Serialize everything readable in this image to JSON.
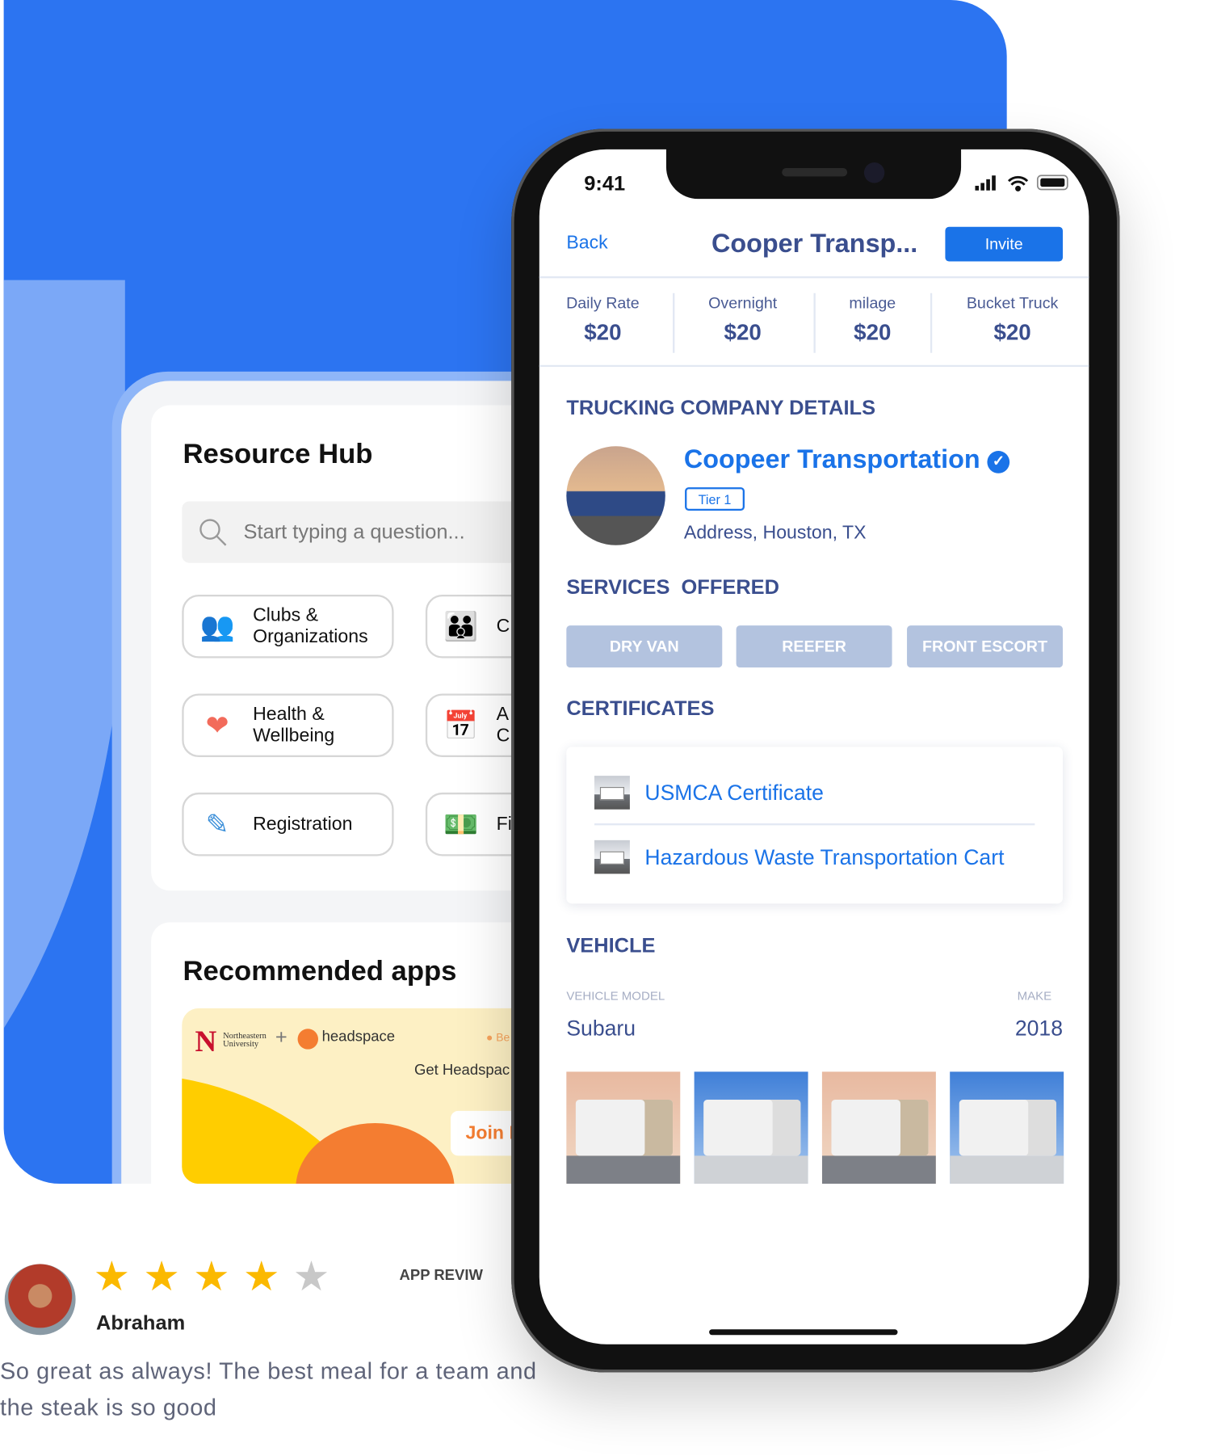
{
  "resource_hub": {
    "title": "Resource Hub",
    "search_placeholder": "Start typing a question...",
    "tiles": [
      {
        "label": "Clubs &\nOrganizations",
        "icon": "people-group-icon"
      },
      {
        "label": "C",
        "icon": "community-icon"
      },
      {
        "label": "Health &\nWellbeing",
        "icon": "heart-pulse-icon"
      },
      {
        "label": "A\nC",
        "icon": "calendar-icon"
      },
      {
        "label": "Registration",
        "icon": "pen-icon"
      },
      {
        "label": "Fi",
        "icon": "money-icon"
      }
    ]
  },
  "recommended": {
    "title": "Recommended apps",
    "banner": {
      "partner": "Northeastern\nUniversity",
      "plus": "+",
      "brand": "headspace",
      "tag": "Be",
      "text": "Get Headspac",
      "join": "Join I"
    }
  },
  "review": {
    "name": "Abraham",
    "rating": 4,
    "max_rating": 5,
    "label": "APP REVIW",
    "text": "So great as always! The best meal for a team and the steak is so good"
  },
  "phone": {
    "status": {
      "time": "9:41"
    },
    "nav": {
      "back": "Back",
      "title": "Cooper Transp...",
      "invite": "Invite"
    },
    "rates": [
      {
        "label": "Daily Rate",
        "value": "$20"
      },
      {
        "label": "Overnight",
        "value": "$20"
      },
      {
        "label": "milage",
        "value": "$20"
      },
      {
        "label": "Bucket Truck",
        "value": "$20"
      }
    ],
    "company_section": "TRUCKING COMPANY DETAILS",
    "company": {
      "name": "Coopeer Transportation",
      "verified": true,
      "tier": "Tier 1",
      "address": "Address, Houston, TX"
    },
    "services_title": "SERVICES  OFFERED",
    "services": [
      "DRY VAN",
      "REEFER",
      "FRONT ESCORT"
    ],
    "certificates_title": "CERTIFICATES",
    "certificates": [
      "USMCA Certificate",
      "Hazardous Waste Transportation Cart"
    ],
    "vehicle_title": "VEHICLE",
    "vehicle": {
      "model_label": "VEHICLE MODEL",
      "model": "Subaru",
      "make_label": "MAKE",
      "make": "2018"
    }
  },
  "colors": {
    "background_blue": "#2c74f1",
    "accent": "#1a73e8",
    "navy": "#3a4e8e",
    "chip": "#b3c3df",
    "star": "#fbb900"
  }
}
